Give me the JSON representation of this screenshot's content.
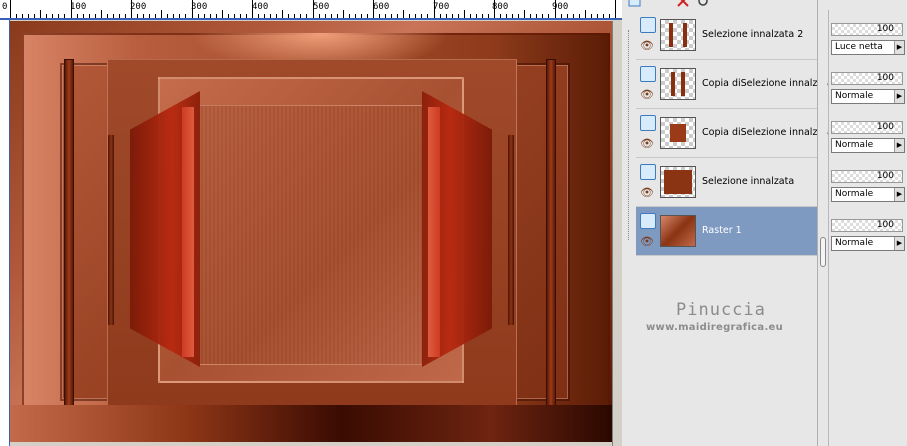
{
  "ruler": {
    "marks": [
      "0",
      "100",
      "200",
      "300",
      "400",
      "500",
      "600",
      "700",
      "800",
      "900"
    ]
  },
  "layers": [
    {
      "name": "Selezione innalzata 2",
      "opacity": "100",
      "blend": "Luce netta",
      "selected": false
    },
    {
      "name": "Copia diSelezione innalzata",
      "opacity": "100",
      "blend": "Normale",
      "selected": false
    },
    {
      "name": "Copia diSelezione innalzata",
      "opacity": "100",
      "blend": "Normale",
      "selected": false
    },
    {
      "name": "Selezione innalzata",
      "opacity": "100",
      "blend": "Normale",
      "selected": false
    },
    {
      "name": "Raster 1",
      "opacity": "100",
      "blend": "Normale",
      "selected": true
    }
  ],
  "watermark": {
    "name": "Pinuccia",
    "url": "www.maidiregrafica.eu"
  },
  "colors": {
    "selection": "#7f9ac1",
    "image_accent": "#b85e3e"
  },
  "icons": {
    "visibility": "eye-icon",
    "layer_type": "layer-stack-icon",
    "dropdown": "triangle-right-icon"
  }
}
